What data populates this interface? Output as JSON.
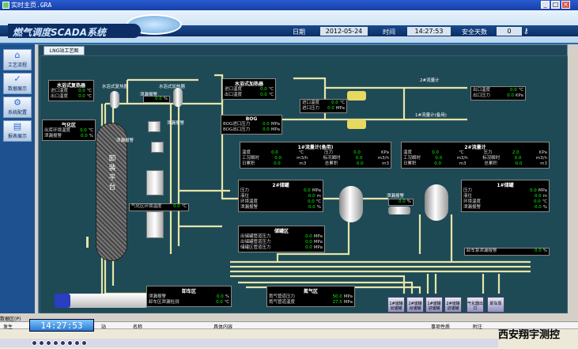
{
  "window": {
    "title": "实时主页.GRA",
    "buttons": [
      "_",
      "□",
      "×"
    ]
  },
  "header": {
    "system_name": "燃气调度SCADA系统",
    "date_label": "日期",
    "date_value": "2012-05-24",
    "time_label": "时间",
    "time_value": "14:27:53",
    "safe_label": "安全天数",
    "safe_value": "0"
  },
  "sidebar": {
    "items": [
      {
        "label": "工艺流程",
        "icon": "home-icon"
      },
      {
        "label": "数据展示",
        "icon": "chart-icon"
      },
      {
        "label": "系统配置",
        "icon": "gear-icon"
      },
      {
        "label": "报表展示",
        "icon": "report-icon"
      }
    ]
  },
  "tab": "LNG站工艺图",
  "panels": {
    "water_bath": {
      "title": "水浴式复热器",
      "rows": [
        [
          "进口温度",
          "0.0",
          "℃"
        ],
        [
          "出口温度",
          "0.0",
          "℃"
        ]
      ]
    },
    "water_heater": {
      "title": "水浴式加热器",
      "rows": [
        [
          "进口温度",
          "0.0",
          "℃"
        ],
        [
          "出口温度",
          "0.0",
          "℃"
        ]
      ]
    },
    "gasifier": {
      "title": "气化区",
      "rows": [
        [
          "出库环境温度",
          "0.0",
          "℃"
        ],
        [
          "泄漏报警",
          "0.0",
          "%"
        ]
      ]
    },
    "bog": {
      "title": "BOG",
      "rows": [
        [
          "BOG进口压力",
          "0.0",
          "MPa"
        ],
        [
          "BOG出口压力",
          "0.0",
          "MPa"
        ]
      ]
    },
    "flow2": {
      "title": "2#流量计",
      "rows": [
        [
          "出口温度",
          "0.0",
          "℃"
        ],
        [
          "出口压力",
          "0.0",
          "KPa"
        ]
      ]
    },
    "flow1": {
      "title": "1#流量计(备用)",
      "rows": [
        [
          "温度",
          "0.0",
          "℃",
          "压力",
          "0.0",
          "KPa"
        ],
        [
          "工况瞬时",
          "0.0",
          "m3/h",
          "标况瞬时",
          "0.0",
          "m3/h"
        ],
        [
          "日累积",
          "0.0",
          "m3",
          "总累积",
          "0.0",
          "m3"
        ]
      ]
    },
    "flow2b": {
      "title": "2#流量计",
      "rows": [
        [
          "温度",
          "0.0",
          "℃",
          "压力",
          "2.0",
          "KPa"
        ],
        [
          "工况瞬时",
          "0.0",
          "m3/h",
          "标况瞬时",
          "0.0",
          "m3/h"
        ],
        [
          "日累积",
          "0.0",
          "m3",
          "总累积",
          "0.0",
          "m3"
        ]
      ]
    },
    "tank2": {
      "title": "2#储罐",
      "rows": [
        [
          "压力",
          "0.0",
          "MPa"
        ],
        [
          "液位",
          "0.0",
          "m"
        ],
        [
          "环境温度",
          "0.0",
          "℃"
        ],
        [
          "泄漏报警",
          "0.0",
          "%"
        ]
      ]
    },
    "tank1": {
      "title": "1#储罐",
      "rows": [
        [
          "压力",
          "0.0",
          "MPa"
        ],
        [
          "液位",
          "0.0",
          "m"
        ],
        [
          "环境温度",
          "0.0",
          "℃"
        ],
        [
          "泄漏报警",
          "0.0",
          "%"
        ]
      ]
    },
    "storage": {
      "title": "储罐区",
      "rows": [
        [
          "出储罐管道压力",
          "0.0",
          "MPa"
        ],
        [
          "出储罐管道压力",
          "0.0",
          "MPa"
        ],
        [
          "储罐区管道压力",
          "0.0",
          "MPa"
        ]
      ]
    },
    "unload": {
      "title": "卸车区",
      "rows": [
        [
          "泄漏报警",
          "0.0",
          "%"
        ],
        [
          "卸车区泄漏检测",
          "0.0",
          "℃"
        ]
      ]
    },
    "nitrogen": {
      "title": "氮气区",
      "rows": [
        [
          "氮气管道压力",
          "50.0",
          "MPa"
        ],
        [
          "氮气管道温度",
          "27.5",
          "MPa"
        ]
      ]
    }
  },
  "labels": {
    "heater_leak": "泄漏报警",
    "heater_leak_val": "0.0",
    "heater_leak_unit": "%",
    "gas_leak1": "泄漏报警",
    "gas_leak2": "泄漏报警",
    "vapor_temp": "气化区环境温度",
    "vapor_temp_val": "0.0",
    "vapor_temp_unit": "℃",
    "pipe_in_temp": "进口温度",
    "pipe_in_press": "进口压力",
    "pipe_temp_val": "0.0",
    "pipe_temp_unit": "℃",
    "pipe_press_val": "0.0",
    "pipe_press_unit": "MPa",
    "flowmeter2": "2#流量计",
    "flowmeter1": "1#流量计(备用)",
    "tank_leak": "泄漏报警",
    "tank_leak_val": "0.0",
    "tank_leak_unit": "%",
    "pump_leak": "卸车泵泄漏报警",
    "pump_leak_val": "0.0",
    "pump_leak_unit": "%",
    "truck_platform": [
      "卸",
      "装",
      "平",
      "台"
    ]
  },
  "station_buttons": [
    "1#储罐出储罐",
    "2#储罐出储罐",
    "1#储罐进储罐",
    "2#储罐进储罐",
    "气化器出口",
    "卸车泵"
  ],
  "alarm_bar": {
    "title": "数据区(P)",
    "columns": [
      "发生",
      "站",
      "名称",
      "具体内容",
      "事项性质",
      "附注"
    ]
  },
  "clock": "14:27:53",
  "watermark": "西安翔宇测控"
}
